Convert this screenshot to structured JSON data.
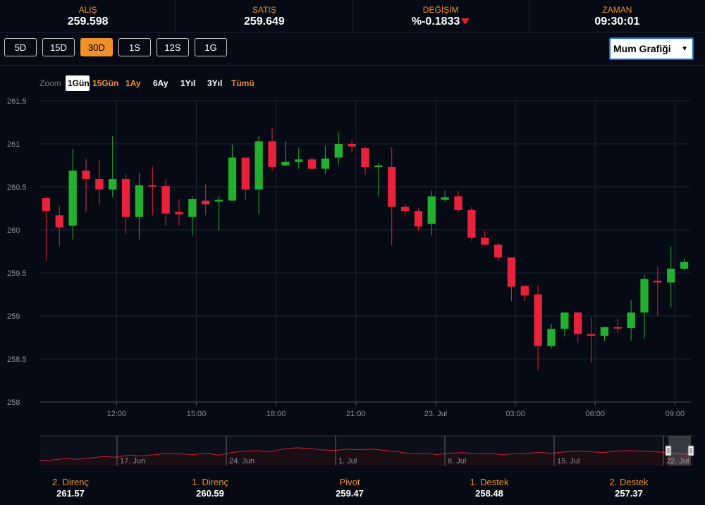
{
  "quotes": [
    {
      "label": "ALIŞ",
      "value": "259.598"
    },
    {
      "label": "SATIŞ",
      "value": "259.649"
    },
    {
      "label": "DEĞİŞİM",
      "value": "%-0.1833"
    },
    {
      "label": "ZAMAN",
      "value": "09:30:01"
    }
  ],
  "periods": [
    "5D",
    "15D",
    "30D",
    "1S",
    "12S",
    "1G"
  ],
  "active_period": "30D",
  "chart_type": {
    "label": "Mum Grafiği"
  },
  "zoom": {
    "label": "Zoom",
    "options": [
      "1Gün",
      "15Gün",
      "1Ay",
      "6Ay",
      "1Yıl",
      "3Yıl",
      "Tümü"
    ],
    "selected": "1Gün"
  },
  "colors": {
    "up": "#22b02e",
    "down": "#e8223a",
    "accent": "#f0902a",
    "background": "#050a14"
  },
  "chart_data": {
    "type": "candlestick",
    "title": "",
    "xlabel": "",
    "ylabel": "",
    "ylim": [
      258,
      261.5
    ],
    "yticks": [
      "261.5",
      "261",
      "260.5",
      "260",
      "259.5",
      "259",
      "258.5",
      "258"
    ],
    "xtick_labels": [
      "12:00",
      "15:00",
      "18:00",
      "21:00",
      "23. Jul",
      "03:00",
      "06:00",
      "09:00"
    ],
    "grid": true,
    "candles": [
      {
        "o": 260.37,
        "h": 260.39,
        "l": 259.64,
        "c": 260.22
      },
      {
        "o": 260.17,
        "h": 260.28,
        "l": 259.81,
        "c": 260.03
      },
      {
        "o": 260.05,
        "h": 260.94,
        "l": 259.89,
        "c": 260.69
      },
      {
        "o": 260.69,
        "h": 260.83,
        "l": 260.21,
        "c": 260.59
      },
      {
        "o": 260.59,
        "h": 260.82,
        "l": 260.29,
        "c": 260.47
      },
      {
        "o": 260.47,
        "h": 261.09,
        "l": 260.38,
        "c": 260.59
      },
      {
        "o": 260.59,
        "h": 260.65,
        "l": 259.95,
        "c": 260.15
      },
      {
        "o": 260.15,
        "h": 260.66,
        "l": 259.89,
        "c": 260.52
      },
      {
        "o": 260.52,
        "h": 260.74,
        "l": 260.17,
        "c": 260.51
      },
      {
        "o": 260.51,
        "h": 260.59,
        "l": 260.05,
        "c": 260.19
      },
      {
        "o": 260.21,
        "h": 260.36,
        "l": 260.05,
        "c": 260.18
      },
      {
        "o": 260.15,
        "h": 260.39,
        "l": 259.93,
        "c": 260.36
      },
      {
        "o": 260.34,
        "h": 260.53,
        "l": 260.17,
        "c": 260.3
      },
      {
        "o": 260.33,
        "h": 260.4,
        "l": 260.0,
        "c": 260.35
      },
      {
        "o": 260.34,
        "h": 260.99,
        "l": 260.35,
        "c": 260.84
      },
      {
        "o": 260.84,
        "h": 260.83,
        "l": 260.34,
        "c": 260.47
      },
      {
        "o": 260.47,
        "h": 261.09,
        "l": 260.18,
        "c": 261.03
      },
      {
        "o": 261.03,
        "h": 261.19,
        "l": 260.69,
        "c": 260.73
      },
      {
        "o": 260.75,
        "h": 261.03,
        "l": 260.74,
        "c": 260.79
      },
      {
        "o": 260.79,
        "h": 260.95,
        "l": 260.71,
        "c": 260.82
      },
      {
        "o": 260.82,
        "h": 260.85,
        "l": 260.7,
        "c": 260.71
      },
      {
        "o": 260.71,
        "h": 260.98,
        "l": 260.65,
        "c": 260.83
      },
      {
        "o": 260.84,
        "h": 261.13,
        "l": 260.76,
        "c": 261.0
      },
      {
        "o": 261.0,
        "h": 261.05,
        "l": 260.9,
        "c": 260.97
      },
      {
        "o": 260.95,
        "h": 260.97,
        "l": 260.64,
        "c": 260.73
      },
      {
        "o": 260.73,
        "h": 260.78,
        "l": 260.39,
        "c": 260.75
      },
      {
        "o": 260.73,
        "h": 260.96,
        "l": 259.82,
        "c": 260.27
      },
      {
        "o": 260.27,
        "h": 260.3,
        "l": 260.15,
        "c": 260.22
      },
      {
        "o": 260.22,
        "h": 260.25,
        "l": 259.99,
        "c": 260.04
      },
      {
        "o": 260.07,
        "h": 260.46,
        "l": 259.94,
        "c": 260.39
      },
      {
        "o": 260.35,
        "h": 260.46,
        "l": 260.33,
        "c": 260.38
      },
      {
        "o": 260.39,
        "h": 260.45,
        "l": 260.21,
        "c": 260.23
      },
      {
        "o": 260.23,
        "h": 260.27,
        "l": 259.87,
        "c": 259.91
      },
      {
        "o": 259.91,
        "h": 259.99,
        "l": 259.82,
        "c": 259.83
      },
      {
        "o": 259.83,
        "h": 259.85,
        "l": 259.64,
        "c": 259.68
      },
      {
        "o": 259.68,
        "h": 259.64,
        "l": 259.17,
        "c": 259.34
      },
      {
        "o": 259.35,
        "h": 259.3,
        "l": 259.17,
        "c": 259.24
      },
      {
        "o": 259.25,
        "h": 259.36,
        "l": 258.37,
        "c": 258.65
      },
      {
        "o": 258.65,
        "h": 258.91,
        "l": 258.62,
        "c": 258.85
      },
      {
        "o": 258.85,
        "h": 259.04,
        "l": 258.76,
        "c": 259.04
      },
      {
        "o": 259.04,
        "h": 259.05,
        "l": 258.69,
        "c": 258.79
      },
      {
        "o": 258.79,
        "h": 258.99,
        "l": 258.46,
        "c": 258.77
      },
      {
        "o": 258.77,
        "h": 258.85,
        "l": 258.71,
        "c": 258.87
      },
      {
        "o": 258.87,
        "h": 258.97,
        "l": 258.8,
        "c": 258.86
      },
      {
        "o": 258.86,
        "h": 259.19,
        "l": 258.71,
        "c": 259.04
      },
      {
        "o": 259.04,
        "h": 259.48,
        "l": 258.74,
        "c": 259.43
      },
      {
        "o": 259.41,
        "h": 259.57,
        "l": 259.0,
        "c": 259.39
      },
      {
        "o": 259.39,
        "h": 259.81,
        "l": 259.1,
        "c": 259.55
      },
      {
        "o": 259.55,
        "h": 259.67,
        "l": 259.53,
        "c": 259.63
      }
    ]
  },
  "navigator": {
    "labels": [
      "17. Jun",
      "24. Jun",
      "1. Jul",
      "8. Jul",
      "15. Jul",
      "22. Jul"
    ],
    "series": [
      258.7,
      258.8,
      259.0,
      258.9,
      259.1,
      259.3,
      259.2,
      259.5,
      259.4,
      259.6,
      259.8,
      259.7,
      259.6,
      259.8,
      259.5,
      259.9,
      260.1,
      260.2,
      260.0,
      260.4,
      260.6,
      260.5,
      260.3,
      260.2,
      260.4,
      260.3,
      260.4,
      260.2,
      260.0,
      259.7,
      259.8,
      259.6,
      259.8,
      259.9,
      259.7,
      259.8,
      259.6,
      259.7,
      259.8,
      259.9,
      259.8,
      260.0,
      260.1,
      260.0,
      259.9,
      260.1,
      260.2,
      260.1,
      260.0,
      259.9,
      259.7,
      259.6
    ]
  },
  "levels": [
    {
      "label": "2. Direnç",
      "value": "261.57"
    },
    {
      "label": "1. Direnç",
      "value": "260.59"
    },
    {
      "label": "Pivot",
      "value": "259.47"
    },
    {
      "label": "1. Destek",
      "value": "258.48"
    },
    {
      "label": "2. Destek",
      "value": "257.37"
    }
  ]
}
